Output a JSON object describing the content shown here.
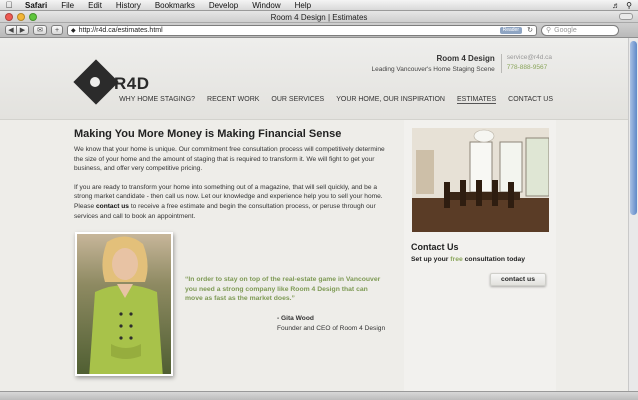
{
  "menubar": {
    "app": "Safari",
    "items": [
      "File",
      "Edit",
      "History",
      "Bookmarks",
      "Develop",
      "Window",
      "Help"
    ]
  },
  "window": {
    "title": "Room 4 Design | Estimates"
  },
  "toolbar": {
    "url": "http://r4d.ca/estimates.html",
    "reader_label": "Reader",
    "search_placeholder": "Google"
  },
  "site": {
    "logo_text": "R4D",
    "brand_name": "Room 4 Design",
    "brand_tagline": "Leading Vancouver's Home Staging Scene",
    "email": "service@r4d.ca",
    "phone": "778-888-9567",
    "nav": [
      {
        "label": "WHY HOME STAGING?"
      },
      {
        "label": "RECENT WORK"
      },
      {
        "label": "OUR SERVICES"
      },
      {
        "label": "YOUR HOME, OUR INSPIRATION"
      },
      {
        "label": "ESTIMATES",
        "active": true
      },
      {
        "label": "CONTACT US"
      }
    ]
  },
  "main": {
    "heading": "Making You More Money is Making Financial Sense",
    "para1": "We know that your home is unique. Our commitment free consultation process will competitively determine the size of your home and the amount of staging that is required to transform it. We will fight to get your business, and offer very competitive pricing.",
    "para2_before": "If you are ready to transform your home into something out of a magazine, that will sell quickly, and be a strong market candidate - then call us now. Let our knowledge and experience help you to sell your home. Please ",
    "para2_link": "contact us",
    "para2_after": " to receive a free estimate and begin the consultation process, or peruse through our services and call to book an appointment.",
    "quote": "“In order to stay on top of the real-estate game in Vancouver you need a strong company like Room 4 Design that can move as fast as the market does.”",
    "quote_name": "- Gita Wood",
    "quote_role": "Founder and CEO of Room 4 Design"
  },
  "sidebar": {
    "title": "Contact Us",
    "sub_before": "Set up your ",
    "sub_free": "free",
    "sub_after": " consultation today",
    "button": "contact us"
  },
  "colors": {
    "accent_green": "#8aa55b",
    "page_bg": "#eeede9"
  }
}
